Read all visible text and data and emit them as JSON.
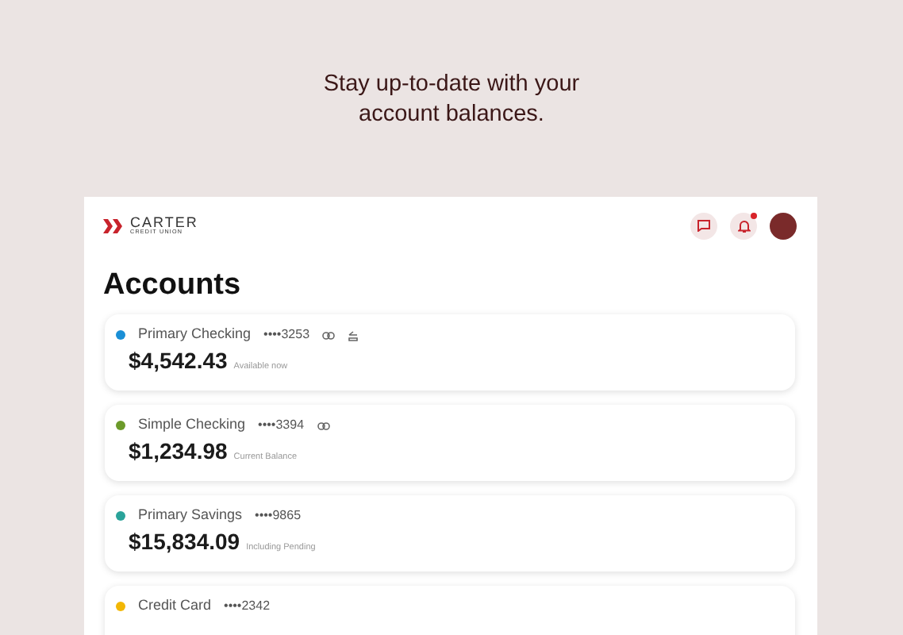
{
  "headline": "Stay up-to-date with your account balances.",
  "logo": {
    "name": "CARTER",
    "subtitle": "CREDIT UNION"
  },
  "header": {
    "notifications_unread": true
  },
  "page_title": "Accounts",
  "accounts": [
    {
      "name": "Primary Checking",
      "number": "••••3253",
      "color": "#1a8fd6",
      "balance": "$4,542.43",
      "note": "Available now",
      "icons": [
        {
          "kind": "link"
        },
        {
          "kind": "transfer"
        }
      ]
    },
    {
      "name": "Simple Checking",
      "number": "••••3394",
      "color": "#6c9a2a",
      "balance": "$1,234.98",
      "note": "Current Balance",
      "icons": [
        {
          "kind": "link"
        }
      ]
    },
    {
      "name": "Primary Savings",
      "number": "••••9865",
      "color": "#2aa39a",
      "balance": "$15,834.09",
      "note": "Including Pending"
    },
    {
      "name": "Credit Card",
      "number": "••••2342",
      "color": "#f2b705"
    }
  ]
}
